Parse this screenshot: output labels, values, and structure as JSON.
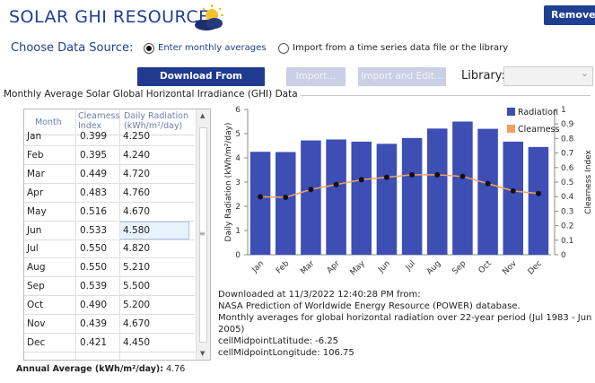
{
  "header": {
    "title": "SOLAR GHI RESOURCE",
    "remove_label": "Remove"
  },
  "source": {
    "label": "Choose Data Source:",
    "option_monthly": "Enter monthly averages",
    "option_import": "Import from a time series data file or the library",
    "selected": "monthly"
  },
  "toolbar": {
    "download_label": "Download From Internet...",
    "import_label": "Import...",
    "import_edit_label": "Import and Edit...",
    "library_label": "Library:",
    "library_value": ""
  },
  "panel": {
    "title": "Monthly Average Solar Global Horizontal Irradiance (GHI) Data"
  },
  "table": {
    "headers": {
      "month": "Month",
      "clearness": "Clearness Index",
      "radiation": "Daily Radiation (kWh/m²/day)"
    },
    "rows": [
      {
        "month": "Jan",
        "clearness": "0.399",
        "radiation": "4.250"
      },
      {
        "month": "Feb",
        "clearness": "0.395",
        "radiation": "4.240"
      },
      {
        "month": "Mar",
        "clearness": "0.449",
        "radiation": "4.720"
      },
      {
        "month": "Apr",
        "clearness": "0.483",
        "radiation": "4.760"
      },
      {
        "month": "May",
        "clearness": "0.516",
        "radiation": "4.670"
      },
      {
        "month": "Jun",
        "clearness": "0.533",
        "radiation": "4.580"
      },
      {
        "month": "Jul",
        "clearness": "0.550",
        "radiation": "4.820"
      },
      {
        "month": "Aug",
        "clearness": "0.550",
        "radiation": "5.210"
      },
      {
        "month": "Sep",
        "clearness": "0.539",
        "radiation": "5.500"
      },
      {
        "month": "Oct",
        "clearness": "0.490",
        "radiation": "5.200"
      },
      {
        "month": "Nov",
        "clearness": "0.439",
        "radiation": "4.670"
      },
      {
        "month": "Dec",
        "clearness": "0.421",
        "radiation": "4.450"
      }
    ],
    "selected_row": 5
  },
  "annual": {
    "label": "Annual Average (kWh/m²/day):",
    "value": "4.76"
  },
  "chart_data": {
    "type": "bar",
    "categories": [
      "Jan",
      "Feb",
      "Mar",
      "Apr",
      "May",
      "Jun",
      "Jul",
      "Aug",
      "Sep",
      "Oct",
      "Nov",
      "Dec"
    ],
    "series": [
      {
        "name": "Radiation",
        "type": "bar",
        "axis": "left",
        "color": "#3d4fb5",
        "values": [
          4.25,
          4.24,
          4.72,
          4.76,
          4.67,
          4.58,
          4.82,
          5.21,
          5.5,
          5.2,
          4.67,
          4.45
        ]
      },
      {
        "name": "Clearness",
        "type": "line",
        "axis": "right",
        "color": "#f0a060",
        "marker_color": "#111111",
        "values": [
          0.399,
          0.395,
          0.449,
          0.483,
          0.516,
          0.533,
          0.55,
          0.55,
          0.539,
          0.49,
          0.439,
          0.421
        ]
      }
    ],
    "ylabel": "Daily Radiation (kWh/m²/day)",
    "y2label": "Clearness Index",
    "ylim": [
      0,
      6
    ],
    "y2lim": [
      0,
      1
    ],
    "yticks": [
      "0",
      "1",
      "2",
      "3",
      "4",
      "5",
      "6"
    ],
    "y2ticks": [
      "0",
      "0.1",
      "0.2",
      "0.3",
      "0.4",
      "0.5",
      "0.6",
      "0.7",
      "0.8",
      "0.9",
      "1"
    ],
    "legend_position": "top-right",
    "grid": false
  },
  "info": {
    "line1": "Downloaded at 11/3/2022 12:40:28 PM from:",
    "line2": "NASA Prediction of Worldwide Energy Resource (POWER)  database.",
    "line3": "Monthly averages for global horizontal radiation over 22-year period (Jul 1983 - Jun 2005)",
    "line4": "cellMidpointLatitude: -6.25",
    "line5": "cellMidpointLongitude: 106.75"
  },
  "colors": {
    "brand": "#1d3f8f",
    "bar": "#3d4fb5",
    "line": "#f0a060"
  }
}
